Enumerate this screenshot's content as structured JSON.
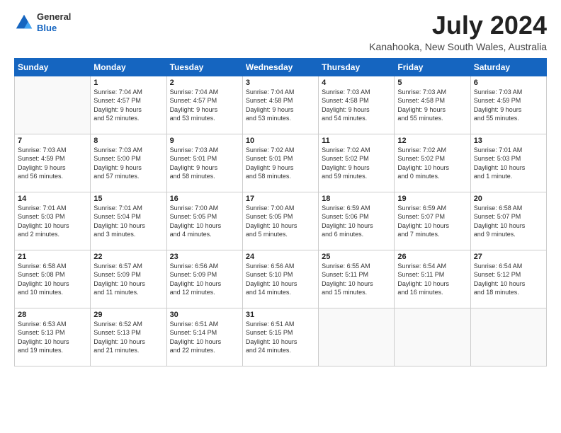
{
  "header": {
    "logo": {
      "general": "General",
      "blue": "Blue"
    },
    "title": "July 2024",
    "location": "Kanahooka, New South Wales, Australia"
  },
  "weekdays": [
    "Sunday",
    "Monday",
    "Tuesday",
    "Wednesday",
    "Thursday",
    "Friday",
    "Saturday"
  ],
  "weeks": [
    [
      {
        "day": "",
        "info": ""
      },
      {
        "day": "1",
        "info": "Sunrise: 7:04 AM\nSunset: 4:57 PM\nDaylight: 9 hours\nand 52 minutes."
      },
      {
        "day": "2",
        "info": "Sunrise: 7:04 AM\nSunset: 4:57 PM\nDaylight: 9 hours\nand 53 minutes."
      },
      {
        "day": "3",
        "info": "Sunrise: 7:04 AM\nSunset: 4:58 PM\nDaylight: 9 hours\nand 53 minutes."
      },
      {
        "day": "4",
        "info": "Sunrise: 7:03 AM\nSunset: 4:58 PM\nDaylight: 9 hours\nand 54 minutes."
      },
      {
        "day": "5",
        "info": "Sunrise: 7:03 AM\nSunset: 4:58 PM\nDaylight: 9 hours\nand 55 minutes."
      },
      {
        "day": "6",
        "info": "Sunrise: 7:03 AM\nSunset: 4:59 PM\nDaylight: 9 hours\nand 55 minutes."
      }
    ],
    [
      {
        "day": "7",
        "info": "Sunrise: 7:03 AM\nSunset: 4:59 PM\nDaylight: 9 hours\nand 56 minutes."
      },
      {
        "day": "8",
        "info": "Sunrise: 7:03 AM\nSunset: 5:00 PM\nDaylight: 9 hours\nand 57 minutes."
      },
      {
        "day": "9",
        "info": "Sunrise: 7:03 AM\nSunset: 5:01 PM\nDaylight: 9 hours\nand 58 minutes."
      },
      {
        "day": "10",
        "info": "Sunrise: 7:02 AM\nSunset: 5:01 PM\nDaylight: 9 hours\nand 58 minutes."
      },
      {
        "day": "11",
        "info": "Sunrise: 7:02 AM\nSunset: 5:02 PM\nDaylight: 9 hours\nand 59 minutes."
      },
      {
        "day": "12",
        "info": "Sunrise: 7:02 AM\nSunset: 5:02 PM\nDaylight: 10 hours\nand 0 minutes."
      },
      {
        "day": "13",
        "info": "Sunrise: 7:01 AM\nSunset: 5:03 PM\nDaylight: 10 hours\nand 1 minute."
      }
    ],
    [
      {
        "day": "14",
        "info": "Sunrise: 7:01 AM\nSunset: 5:03 PM\nDaylight: 10 hours\nand 2 minutes."
      },
      {
        "day": "15",
        "info": "Sunrise: 7:01 AM\nSunset: 5:04 PM\nDaylight: 10 hours\nand 3 minutes."
      },
      {
        "day": "16",
        "info": "Sunrise: 7:00 AM\nSunset: 5:05 PM\nDaylight: 10 hours\nand 4 minutes."
      },
      {
        "day": "17",
        "info": "Sunrise: 7:00 AM\nSunset: 5:05 PM\nDaylight: 10 hours\nand 5 minutes."
      },
      {
        "day": "18",
        "info": "Sunrise: 6:59 AM\nSunset: 5:06 PM\nDaylight: 10 hours\nand 6 minutes."
      },
      {
        "day": "19",
        "info": "Sunrise: 6:59 AM\nSunset: 5:07 PM\nDaylight: 10 hours\nand 7 minutes."
      },
      {
        "day": "20",
        "info": "Sunrise: 6:58 AM\nSunset: 5:07 PM\nDaylight: 10 hours\nand 9 minutes."
      }
    ],
    [
      {
        "day": "21",
        "info": "Sunrise: 6:58 AM\nSunset: 5:08 PM\nDaylight: 10 hours\nand 10 minutes."
      },
      {
        "day": "22",
        "info": "Sunrise: 6:57 AM\nSunset: 5:09 PM\nDaylight: 10 hours\nand 11 minutes."
      },
      {
        "day": "23",
        "info": "Sunrise: 6:56 AM\nSunset: 5:09 PM\nDaylight: 10 hours\nand 12 minutes."
      },
      {
        "day": "24",
        "info": "Sunrise: 6:56 AM\nSunset: 5:10 PM\nDaylight: 10 hours\nand 14 minutes."
      },
      {
        "day": "25",
        "info": "Sunrise: 6:55 AM\nSunset: 5:11 PM\nDaylight: 10 hours\nand 15 minutes."
      },
      {
        "day": "26",
        "info": "Sunrise: 6:54 AM\nSunset: 5:11 PM\nDaylight: 10 hours\nand 16 minutes."
      },
      {
        "day": "27",
        "info": "Sunrise: 6:54 AM\nSunset: 5:12 PM\nDaylight: 10 hours\nand 18 minutes."
      }
    ],
    [
      {
        "day": "28",
        "info": "Sunrise: 6:53 AM\nSunset: 5:13 PM\nDaylight: 10 hours\nand 19 minutes."
      },
      {
        "day": "29",
        "info": "Sunrise: 6:52 AM\nSunset: 5:13 PM\nDaylight: 10 hours\nand 21 minutes."
      },
      {
        "day": "30",
        "info": "Sunrise: 6:51 AM\nSunset: 5:14 PM\nDaylight: 10 hours\nand 22 minutes."
      },
      {
        "day": "31",
        "info": "Sunrise: 6:51 AM\nSunset: 5:15 PM\nDaylight: 10 hours\nand 24 minutes."
      },
      {
        "day": "",
        "info": ""
      },
      {
        "day": "",
        "info": ""
      },
      {
        "day": "",
        "info": ""
      }
    ]
  ]
}
